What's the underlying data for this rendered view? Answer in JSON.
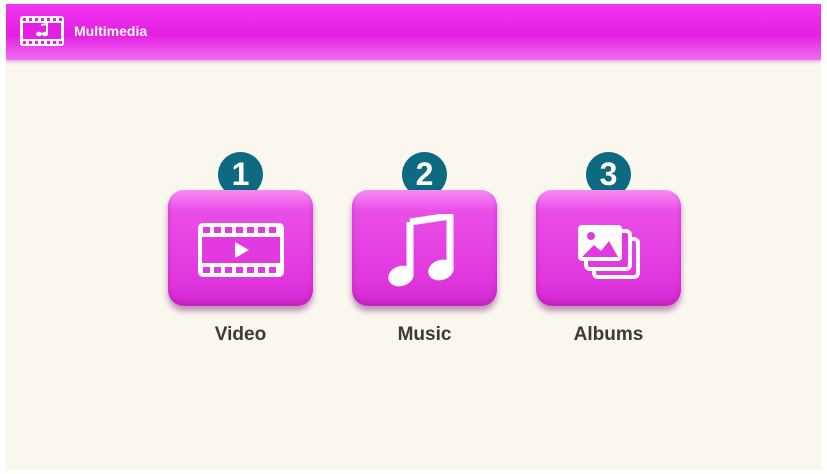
{
  "app": {
    "title": "Multimedia",
    "icon": "film-music-icon"
  },
  "menu": {
    "items": [
      {
        "number": "1",
        "label": "Video",
        "icon": "video-film-icon"
      },
      {
        "number": "2",
        "label": "Music",
        "icon": "music-note-icon"
      },
      {
        "number": "3",
        "label": "Albums",
        "icon": "photo-albums-icon"
      }
    ]
  },
  "colors": {
    "titlebar": "#e41fe3",
    "button": "#e23ae0",
    "badge": "#0d6a80",
    "background": "#faf7ef",
    "label_text": "#3a3a3a"
  }
}
